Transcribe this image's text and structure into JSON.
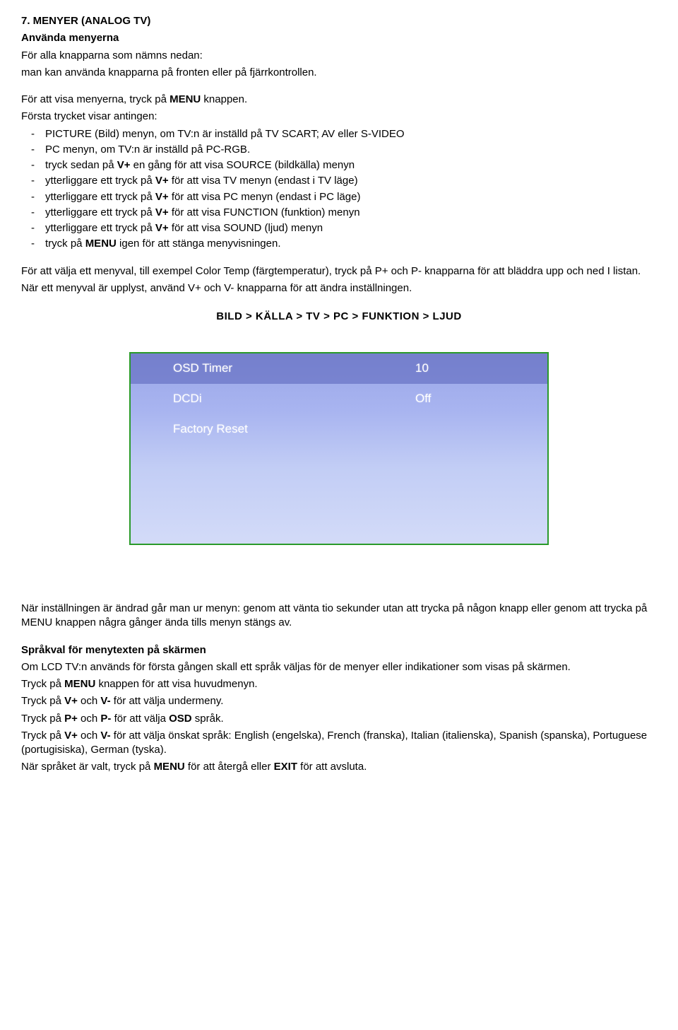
{
  "heading": "7. MENYER (ANALOG TV)",
  "sub1": "Använda menyerna",
  "p1": "För alla knapparna som nämns nedan:",
  "p2": "man kan använda knapparna på fronten eller på fjärrkontrollen.",
  "p3a": "För att visa menyerna, tryck på ",
  "p3b": "MENU",
  "p3c": " knappen.",
  "p4": "Första trycket visar antingen:",
  "li1": "PICTURE (Bild) menyn, om TV:n är inställd på TV SCART; AV eller S-VIDEO",
  "li2": "PC menyn, om TV:n är inställd på PC-RGB.",
  "li3a": "tryck sedan på ",
  "li3b": "V+",
  "li3c": " en gång för att visa SOURCE (bildkälla) menyn",
  "li4a": "ytterliggare ett tryck på ",
  "li4b": "V+",
  "li4c": " för att visa TV menyn (endast i TV läge)",
  "li5a": "ytterliggare ett tryck på ",
  "li5b": "V+",
  "li5c": " för att visa PC menyn (endast i PC läge)",
  "li6a": "ytterliggare ett tryck på ",
  "li6b": "V+",
  "li6c": " för att visa FUNCTION (funktion) menyn",
  "li7a": "ytterliggare ett tryck på ",
  "li7b": "V+",
  "li7c": " för att visa SOUND (ljud) menyn",
  "li8a": "tryck på ",
  "li8b": "MENU",
  "li8c": " igen för att stänga menyvisningen.",
  "p5": "För att välja ett menyval, till exempel Color Temp (färgtemperatur), tryck på P+ och P- knapparna för att bläddra upp och ned I listan.",
  "p6": "När ett menyval är upplyst, använd V+ och V- knapparna för att ändra inställningen.",
  "navline": "BILD > KÄLLA  > TV    >    PC > FUNKTION > LJUD",
  "osd": {
    "row1_label": "OSD Timer",
    "row1_value": "10",
    "row2_label": "DCDi",
    "row2_value": "Off",
    "row3_label": "Factory Reset",
    "row3_value": ""
  },
  "p7": "När inställningen är ändrad går man ur menyn: genom att vänta tio sekunder utan att trycka på någon knapp eller genom att trycka på MENU knappen några gånger ända tills menyn stängs av.",
  "h2": "Språkval för menytexten på skärmen",
  "p8": "Om LCD TV:n används för första gången skall ett språk väljas för de menyer eller indikationer som visas på skärmen.",
  "p9a": "Tryck på ",
  "p9b": "MENU",
  "p9c": " knappen för att visa huvudmenyn.",
  "p10a": "Tryck på ",
  "p10b": "V+",
  "p10c": " och ",
  "p10d": "V-",
  "p10e": " för att välja undermeny.",
  "p11a": "Tryck på ",
  "p11b": "P+",
  "p11c": " och ",
  "p11d": "P-",
  "p11e": " för att välja ",
  "p11f": "OSD",
  "p11g": " språk.",
  "p12a": "Tryck på ",
  "p12b": "V+",
  "p12c": " och ",
  "p12d": "V-",
  "p12e": " för att välja önskat språk: English (engelska), French (franska), Italian (italienska), Spanish (spanska), Portuguese (portugisiska), German (tyska).",
  "p13a": "När språket är valt, tryck på ",
  "p13b": "MENU",
  "p13c": " för att återgå eller ",
  "p13d": "EXIT",
  "p13e": " för att avsluta."
}
